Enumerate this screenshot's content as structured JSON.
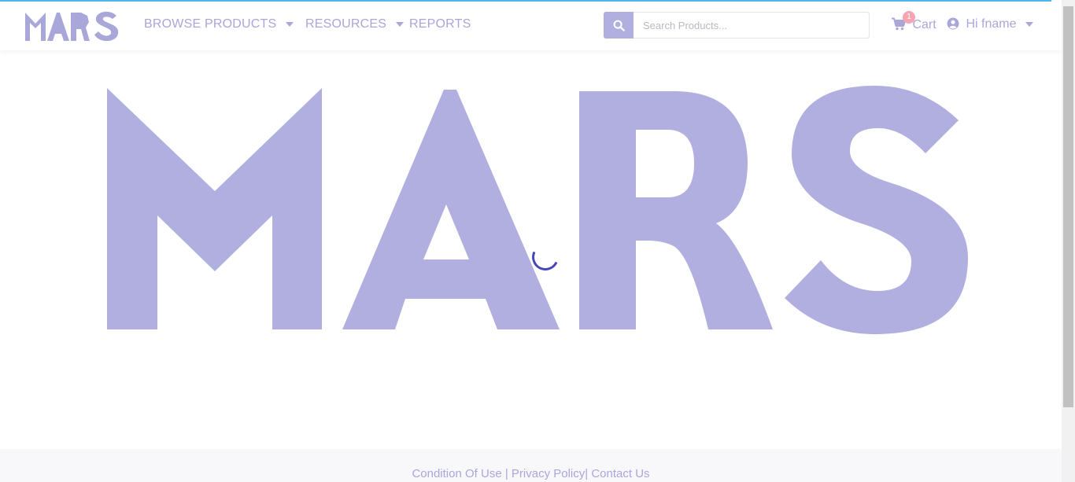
{
  "brand": {
    "name": "MARS",
    "color": "#a9a6da",
    "hero_color": "#b1afe0",
    "spinner_color": "#4646b8"
  },
  "nav": {
    "browse_products": "BROWSE PRODUCTS",
    "resources": "RESOURCES",
    "reports": "REPORTS"
  },
  "search": {
    "placeholder": "Search Products...",
    "value": "",
    "icon": "search-icon"
  },
  "cart": {
    "label": "Cart",
    "count": "1",
    "icon": "shopping-cart-icon"
  },
  "user": {
    "greeting": "Hi fname",
    "icon": "user-circle-icon"
  },
  "footer": {
    "condition_of_use": "Condition Of Use",
    "sep1": " | ",
    "privacy_policy": "Privacy Policy",
    "sep2": "| ",
    "contact_us": "Contact Us"
  }
}
